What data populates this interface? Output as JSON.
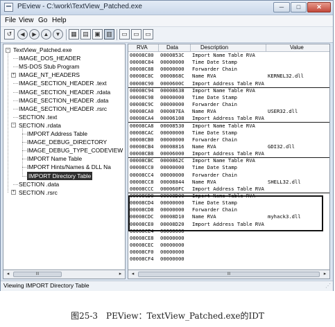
{
  "window": {
    "title": "PEview - C:\\work\\TextView_Patched.exe",
    "controls": {
      "minimize": "─",
      "maximize": "□",
      "close": "✕"
    }
  },
  "menu": [
    "File",
    "View",
    "Go",
    "Help"
  ],
  "toolbar": [
    {
      "name": "open-icon",
      "glyph": "↺"
    },
    {
      "name": "back-icon",
      "glyph": "◀"
    },
    {
      "name": "forward-icon",
      "glyph": "▶"
    },
    {
      "name": "up-icon",
      "glyph": "▲"
    },
    {
      "name": "down-icon",
      "glyph": "▼"
    },
    {
      "name": "byte-view-icon",
      "glyph": "▦"
    },
    {
      "name": "word-view-icon",
      "glyph": "▤"
    },
    {
      "name": "dword-view-icon",
      "glyph": "▣"
    },
    {
      "name": "qword-view-icon",
      "glyph": "▥"
    },
    {
      "name": "structure-view-icon",
      "glyph": "▭"
    },
    {
      "name": "options-icon",
      "glyph": "▭"
    },
    {
      "name": "help-icon",
      "glyph": "▭"
    }
  ],
  "tree": [
    {
      "label": "TextView_Patched.exe",
      "level": 0,
      "expander": "−"
    },
    {
      "label": "IMAGE_DOS_HEADER",
      "level": 1
    },
    {
      "label": "MS-DOS Stub Program",
      "level": 1
    },
    {
      "label": "IMAGE_NT_HEADERS",
      "level": 1,
      "expander": "+"
    },
    {
      "label": "IMAGE_SECTION_HEADER .text",
      "level": 1
    },
    {
      "label": "IMAGE_SECTION_HEADER .rdata",
      "level": 1
    },
    {
      "label": "IMAGE_SECTION_HEADER .data",
      "level": 1
    },
    {
      "label": "IMAGE_SECTION_HEADER .rsrc",
      "level": 1
    },
    {
      "label": "SECTION .text",
      "level": 1
    },
    {
      "label": "SECTION .rdata",
      "level": 1,
      "expander": "−"
    },
    {
      "label": "IMPORT Address Table",
      "level": 2
    },
    {
      "label": "IMAGE_DEBUG_DIRECTORY",
      "level": 2
    },
    {
      "label": "IMAGE_DEBUG_TYPE_CODEVIEW",
      "level": 2
    },
    {
      "label": "IMPORT Name Table",
      "level": 2
    },
    {
      "label": "IMPORT Hints/Names & DLL Na",
      "level": 2
    },
    {
      "label": "IMPORT Directory Table",
      "level": 2,
      "selected": true
    },
    {
      "label": "SECTION .data",
      "level": 1
    },
    {
      "label": "SECTION .rsrc",
      "level": 1,
      "expander": "+"
    }
  ],
  "columns": {
    "rva": "RVA",
    "data": "Data",
    "description": "Description",
    "value": "Value"
  },
  "rows": [
    {
      "rva": "00008C80",
      "data": "0000853C",
      "desc": "Import Name Table RVA",
      "value": ""
    },
    {
      "rva": "00008C84",
      "data": "00000000",
      "desc": "Time Date Stamp",
      "value": ""
    },
    {
      "rva": "00008C88",
      "data": "00000000",
      "desc": "Forwarder Chain",
      "value": ""
    },
    {
      "rva": "00008C8C",
      "data": "0000868C",
      "desc": "Name RVA",
      "value": "KERNEL32.dll"
    },
    {
      "rva": "00008C90",
      "data": "0000600C",
      "desc": "Import Address Table RVA",
      "value": "",
      "sep": true
    },
    {
      "rva": "00008C94",
      "data": "00008638",
      "desc": "Import Name Table RVA",
      "value": ""
    },
    {
      "rva": "00008C98",
      "data": "00000000",
      "desc": "Time Date Stamp",
      "value": ""
    },
    {
      "rva": "00008C9C",
      "data": "00000000",
      "desc": "Forwarder Chain",
      "value": ""
    },
    {
      "rva": "00008CA0",
      "data": "000087EA",
      "desc": "Name RVA",
      "value": "USER32.dll"
    },
    {
      "rva": "00008CA4",
      "data": "00006108",
      "desc": "Import Address Table RVA",
      "value": "",
      "sep": true
    },
    {
      "rva": "00008CA8",
      "data": "00008530",
      "desc": "Import Name Table RVA",
      "value": ""
    },
    {
      "rva": "00008CAC",
      "data": "00000000",
      "desc": "Time Date Stamp",
      "value": ""
    },
    {
      "rva": "00008CB0",
      "data": "00000000",
      "desc": "Forwarder Chain",
      "value": ""
    },
    {
      "rva": "00008CB4",
      "data": "00008816",
      "desc": "Name RVA",
      "value": "GDI32.dll"
    },
    {
      "rva": "00008CB8",
      "data": "00006000",
      "desc": "Import Address Table RVA",
      "value": "",
      "sep": true
    },
    {
      "rva": "00008CBC",
      "data": "0000862C",
      "desc": "Import Name Table RVA",
      "value": ""
    },
    {
      "rva": "00008CC0",
      "data": "00000000",
      "desc": "Time Date Stamp",
      "value": ""
    },
    {
      "rva": "00008CC4",
      "data": "00000000",
      "desc": "Forwarder Chain",
      "value": ""
    },
    {
      "rva": "00008CC8",
      "data": "00008844",
      "desc": "Name RVA",
      "value": "SHELL32.dll"
    },
    {
      "rva": "00008CCC",
      "data": "000060FC",
      "desc": "Import Address Table RVA",
      "value": "",
      "sep": true
    },
    {
      "rva": "00008CD0",
      "data": "00008D00",
      "desc": "Import Name Table RVA",
      "value": ""
    },
    {
      "rva": "00008CD4",
      "data": "00000000",
      "desc": "Time Date Stamp",
      "value": ""
    },
    {
      "rva": "00008CD8",
      "data": "00000000",
      "desc": "Forwarder Chain",
      "value": ""
    },
    {
      "rva": "00008CDC",
      "data": "00008D10",
      "desc": "Name RVA",
      "value": "myhack3.dll"
    },
    {
      "rva": "00008CE0",
      "data": "00008D20",
      "desc": "Import Address Table RVA",
      "value": ""
    },
    {
      "rva": "00008CE4",
      "data": "00000000",
      "desc": "",
      "value": ""
    },
    {
      "rva": "00008CE8",
      "data": "00000000",
      "desc": "",
      "value": ""
    },
    {
      "rva": "00008CEC",
      "data": "00000000",
      "desc": "",
      "value": ""
    },
    {
      "rva": "00008CF0",
      "data": "00000000",
      "desc": "",
      "value": ""
    },
    {
      "rva": "00008CF4",
      "data": "00000000",
      "desc": "",
      "value": ""
    }
  ],
  "scroll": {
    "left": "◂",
    "right": "▸",
    "grip": "III"
  },
  "status": "Viewing IMPORT Directory Table",
  "caption": "图25-3　PEView：TextView_Patched.exe的IDT"
}
